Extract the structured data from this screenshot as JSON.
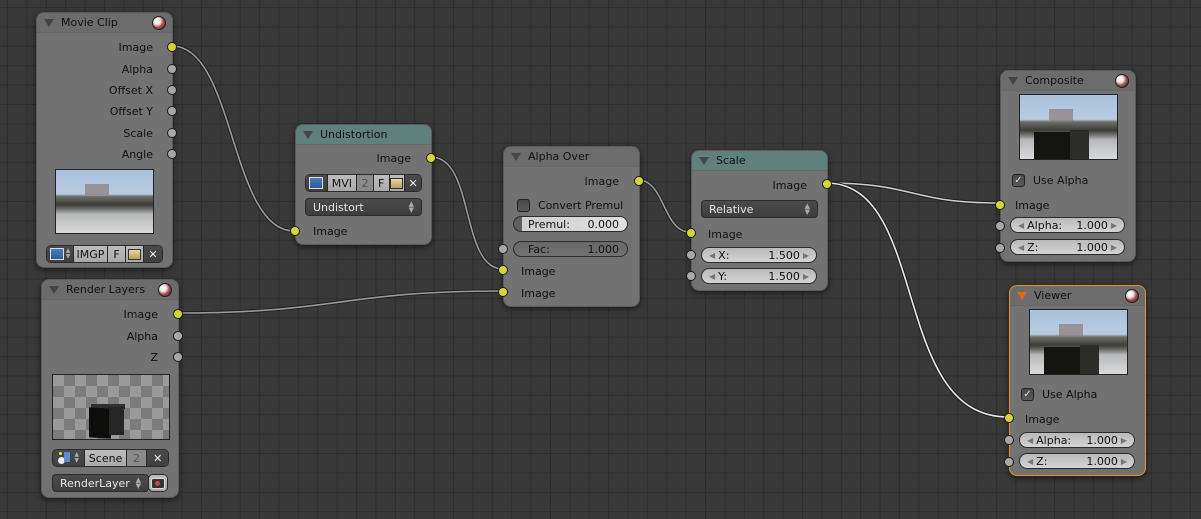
{
  "editor": "Compositor Node Editor",
  "colors": {
    "background": "#393939",
    "node_body": "#727272",
    "header_teal": "#5f807c",
    "socket_image": "#d6d632",
    "socket_value": "#a8a8a8",
    "active_outline": "#e88f2e"
  },
  "nodes": {
    "movie_clip": {
      "title": "Movie Clip",
      "outputs": [
        "Image",
        "Alpha",
        "Offset X",
        "Offset Y",
        "Scale",
        "Angle"
      ],
      "clip_selector": {
        "icon": "movie-clip-icon",
        "name": "IMGP",
        "fake_user": "F",
        "open_icon": "folder-icon",
        "unlink_icon": "close-icon"
      }
    },
    "render_layers": {
      "title": "Render Layers",
      "outputs": [
        "Image",
        "Alpha",
        "Z"
      ],
      "scene_selector": {
        "icon": "scene-icon",
        "name": "Scene",
        "users": "2",
        "unlink_icon": "close-icon"
      },
      "layer_select": {
        "value": "RenderLayer",
        "render_icon": "render-camera-icon"
      }
    },
    "undistortion": {
      "title": "Undistortion",
      "outputs": [
        "Image"
      ],
      "clip_selector": {
        "icon": "movie-clip-icon",
        "name": "MVI",
        "users": "2",
        "fake_user": "F",
        "open_icon": "folder-icon",
        "unlink_icon": "close-icon"
      },
      "mode_select": "Undistort",
      "inputs": [
        "Image"
      ]
    },
    "alpha_over": {
      "title": "Alpha Over",
      "outputs": [
        "Image"
      ],
      "convert_premul": {
        "label": "Convert Premul",
        "checked": false
      },
      "premul": {
        "label": "Premul:",
        "value": "0.000"
      },
      "fac": {
        "label": "Fac:",
        "value": "1.000"
      },
      "inputs": [
        "Image",
        "Image"
      ]
    },
    "scale": {
      "title": "Scale",
      "outputs": [
        "Image"
      ],
      "space_select": "Relative",
      "inputs": [
        "Image"
      ],
      "x": {
        "label": "X:",
        "value": "1.500"
      },
      "y": {
        "label": "Y:",
        "value": "1.500"
      }
    },
    "composite": {
      "title": "Composite",
      "use_alpha": {
        "label": "Use Alpha",
        "checked": true
      },
      "inputs": [
        "Image"
      ],
      "alpha": {
        "label": "Alpha:",
        "value": "1.000"
      },
      "z": {
        "label": "Z:",
        "value": "1.000"
      }
    },
    "viewer": {
      "title": "Viewer",
      "active": true,
      "use_alpha": {
        "label": "Use Alpha",
        "checked": true
      },
      "inputs": [
        "Image"
      ],
      "alpha": {
        "label": "Alpha:",
        "value": "1.000"
      },
      "z": {
        "label": "Z:",
        "value": "1.000"
      }
    }
  },
  "links": [
    {
      "from": "Movie Clip.Image",
      "to": "Undistortion.Image"
    },
    {
      "from": "Undistortion.Image",
      "to": "Alpha Over.Image(1)"
    },
    {
      "from": "Render Layers.Image",
      "to": "Alpha Over.Image(2)"
    },
    {
      "from": "Alpha Over.Image",
      "to": "Scale.Image"
    },
    {
      "from": "Scale.Image",
      "to": "Composite.Image"
    },
    {
      "from": "Scale.Image",
      "to": "Viewer.Image"
    }
  ]
}
